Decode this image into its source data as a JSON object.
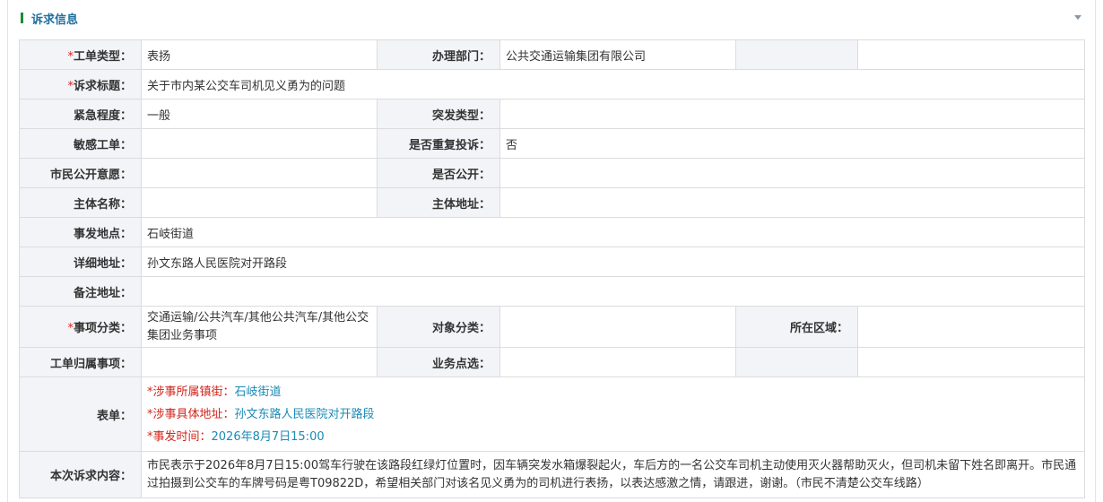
{
  "header": {
    "title": "诉求信息"
  },
  "labels": {
    "ticket_type": "工单类型：",
    "dept": "办理部门：",
    "title": "诉求标题：",
    "urgency": "紧急程度：",
    "emergency_type": "突发类型：",
    "sensitive": "敏感工单：",
    "repeat": "是否重复投诉：",
    "public_will": "市民公开意愿：",
    "is_public": "是否公开：",
    "subject_name": "主体名称：",
    "subject_addr": "主体地址：",
    "location": "事发地点：",
    "detail_addr": "详细地址：",
    "remark_addr": "备注地址：",
    "category": "事项分类：",
    "object_cat": "对象分类：",
    "region": "所在区域：",
    "belongs": "工单归属事项：",
    "biz_point": "业务点选：",
    "form": "表单：",
    "content": "本次诉求内容："
  },
  "required_mark": "*",
  "values": {
    "ticket_type": "表扬",
    "dept": "公共交通运输集团有限公司",
    "title": "关于市内某公交车司机见义勇为的问题",
    "urgency": "一般",
    "repeat": "否",
    "location": "石岐街道",
    "detail_addr": "孙文东路人民医院对开路段",
    "category": "交通运输/公共汽车/其他公共汽车/其他公交集团业务事项",
    "content": "市民表示于2026年8月7日15:00驾车行驶在该路段红绿灯位置时，因车辆突发水箱爆裂起火，车后方的一名公交车司机主动使用灭火器帮助灭火，但司机未留下姓名即离开。市民通过拍摄到公交车的车牌号码是粤T09822D，希望相关部门对该名见义勇为的司机进行表扬，以表达感激之情，请跟进，谢谢。（市民不清楚公交车线路）"
  },
  "form_fields": [
    {
      "label": "*涉事所属镇街：",
      "value": "石岐街道"
    },
    {
      "label": "*涉事具体地址：",
      "value": "孙文东路人民医院对开路段"
    },
    {
      "label": "*事发时间：",
      "value": "2026年8月7日15:00"
    }
  ],
  "icons": {
    "collapse": "caret-down-icon"
  },
  "colors": {
    "header_accent": "#1d8a3a",
    "title": "#1f6f9f",
    "required": "#e02020",
    "form_value": "#1b8ab5"
  }
}
